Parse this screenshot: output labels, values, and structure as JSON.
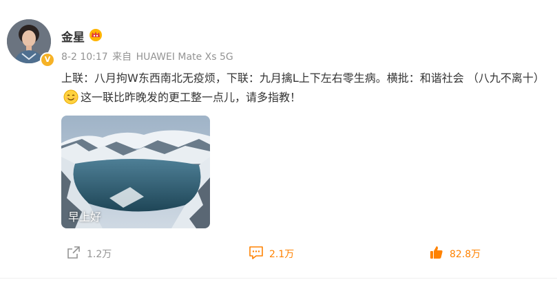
{
  "post": {
    "author": "金星",
    "time": "8-2 10:17",
    "source_prefix": "来自",
    "source_device": "HUAWEI Mate Xs 5G",
    "text_part1": "上联：八月拘W东西南北无疫烦，下联：九月擒L上下左右零生病。横批：和谐社会 （八九不离十）",
    "text_part2": "这一联比昨晚发的更工整一点儿，请多指教！",
    "image_caption": "早上好",
    "verified_badge": "V"
  },
  "actions": {
    "share_count": "1.2万",
    "comment_count": "2.1万",
    "like_count": "82.8万"
  },
  "icons": {
    "avatar": "avatar",
    "verified": "verified-badge-icon",
    "member": "member-crown-icon",
    "emoji": "smile-emoji-icon",
    "share": "share-icon",
    "comment": "comment-icon",
    "like": "thumbs-up-icon"
  },
  "colors": {
    "accent": "#ff8200",
    "muted": "#939393",
    "verified": "#f6b226"
  }
}
